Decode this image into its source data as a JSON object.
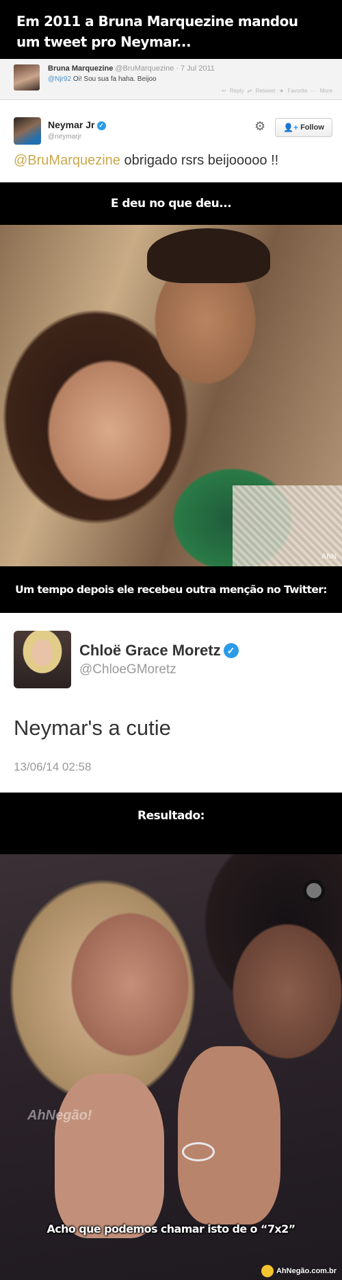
{
  "caption1": "Em 2011 a Bruna Marquezine mandou um tweet pro Neymar...",
  "tweet1": {
    "name": "Bruna Marquezine",
    "handle": "@BruMarquezine · 7 Jul 2011",
    "mention": "@Njr92",
    "text": " Oi! Sou sua fa haha. Beijoo",
    "actions": "↩ Reply ⇄ Retweet ★ Favorite ··· More"
  },
  "tweet2": {
    "name": "Neymar Jr",
    "handle": "@neymarjr",
    "follow_label": "Follow",
    "mention": "@BruMarquezine",
    "text": " obrigado rsrs beijooooo !!"
  },
  "caption2": "E deu no que deu...",
  "photo1": {
    "watermark": "AhN"
  },
  "caption3": "Um tempo depois ele recebeu outra menção no Twitter:",
  "tweet3": {
    "name": "Chloë Grace Moretz",
    "handle": "@ChloeGMoretz",
    "text": "Neymar's a cutie",
    "time": "13/06/14 02:58"
  },
  "caption4": "Resultado:",
  "photo2": {
    "watermark": "AhNegão!",
    "caption": "Acho que podemos chamar isto de o “7x2”",
    "site": "AhNegão.com.br"
  },
  "colors": {
    "background": "#000000",
    "twitter_blue": "#2b9be8",
    "mention_gold": "#c9a84a"
  },
  "icons": [
    "verified-icon",
    "gear-icon",
    "follow-plus-icon"
  ]
}
